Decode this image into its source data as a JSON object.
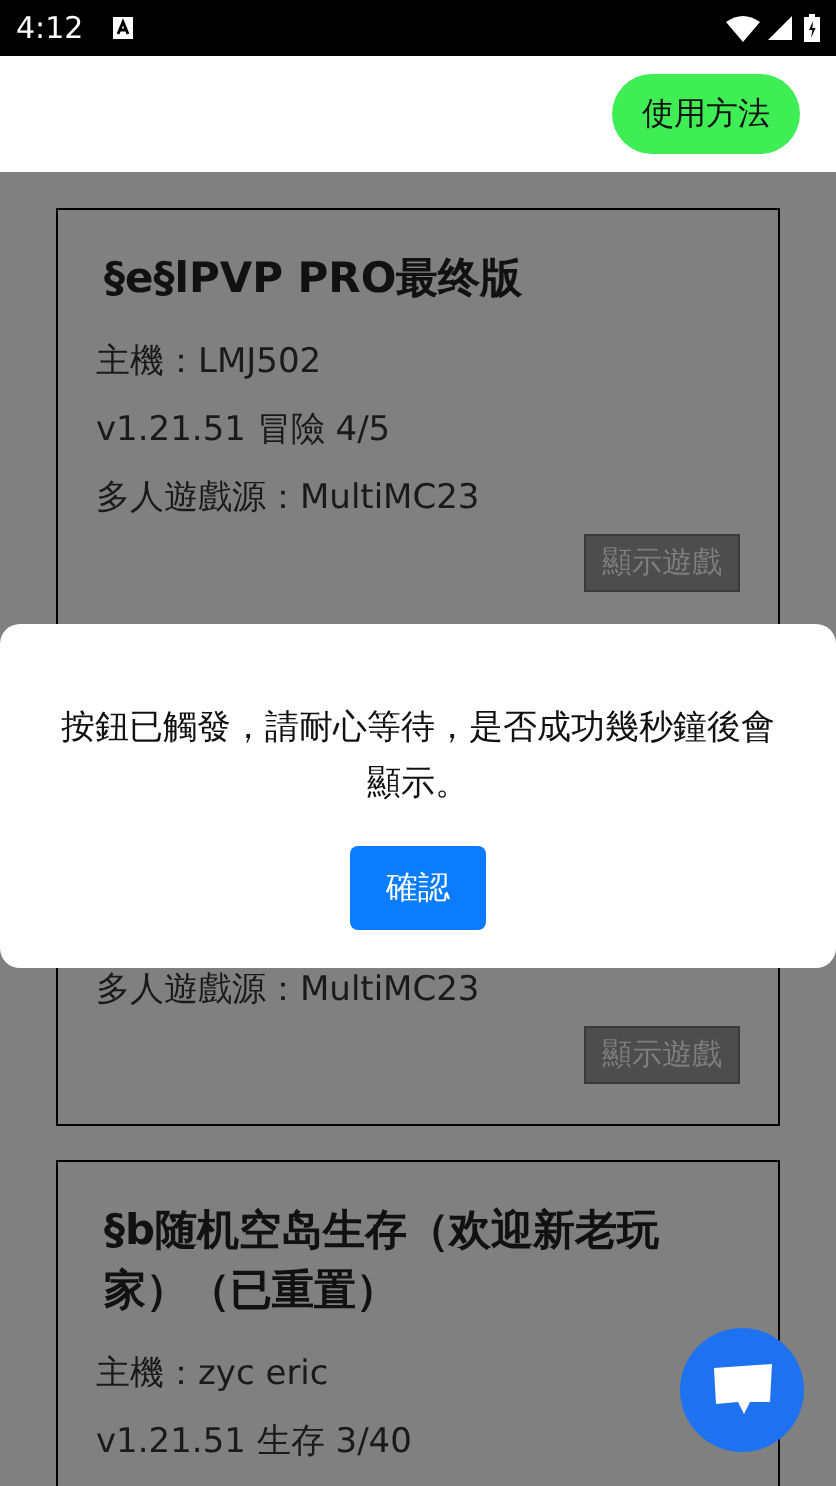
{
  "status_bar": {
    "time": "4:12"
  },
  "header": {
    "help_button": "使用方法"
  },
  "servers": [
    {
      "title": "§e§lPVP PRO最终版",
      "host": "主機：LMJ502",
      "version": "v1.21.51 冒險 4/5",
      "source": "多人遊戲源：MultiMC23",
      "button": "顯示遊戲"
    },
    {
      "source": "多人遊戲源：MultiMC23",
      "button": "顯示遊戲"
    },
    {
      "title": "§b随机空岛生存（欢迎新老玩家）（已重置）",
      "host": "主機：zyc eric",
      "version": "v1.21.51 生存 3/40"
    }
  ],
  "dialog": {
    "message": "按鈕已觸發，請耐心等待，是否成功幾秒鐘後會顯示。",
    "button": "確認"
  }
}
